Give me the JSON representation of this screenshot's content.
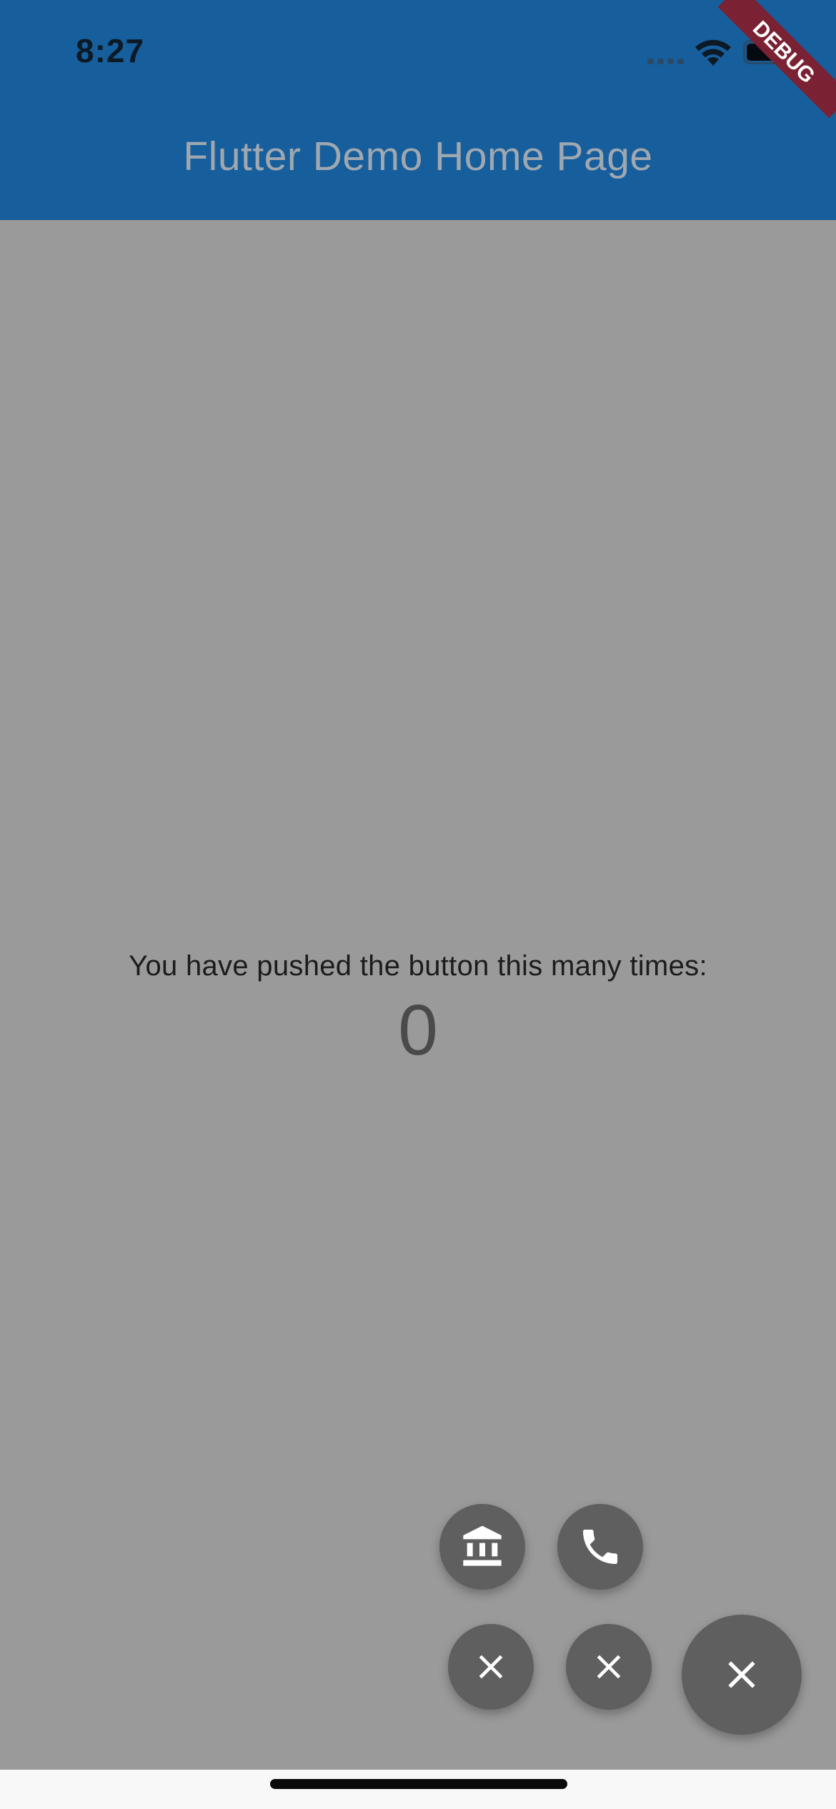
{
  "status_bar": {
    "time": "8:27",
    "icons": [
      "signal-icon",
      "wifi-icon",
      "battery-icon"
    ]
  },
  "debug_banner": {
    "label": "DEBUG",
    "color": "#7a2233"
  },
  "app_bar": {
    "title": "Flutter Demo Home Page",
    "color": "#165e9c"
  },
  "body": {
    "counter_label": "You have pushed the button this many times:",
    "counter_value": "0",
    "scrim_color": "#9a9a9a"
  },
  "fab_menu": {
    "color": "#5f5f5f",
    "icon_color": "#ffffff",
    "items": [
      {
        "name": "bank",
        "icon": "account-balance-icon"
      },
      {
        "name": "phone",
        "icon": "phone-icon"
      },
      {
        "name": "close-left",
        "icon": "close-icon"
      },
      {
        "name": "close-right",
        "icon": "close-icon"
      }
    ],
    "main": {
      "icon": "close-icon"
    }
  }
}
